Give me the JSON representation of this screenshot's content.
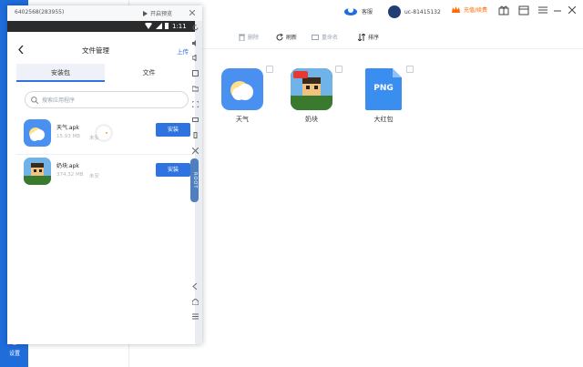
{
  "colors": {
    "accent": "#2f73e0",
    "nav": "#1f6ddb",
    "orange": "#ff6a00"
  },
  "phone": {
    "title": "6402568(283955)",
    "preview_label": "开启预览",
    "status_time": "1:11",
    "side_root": "ROOT",
    "header": {
      "title": "文件管理",
      "upload": "上传"
    },
    "tabs": [
      {
        "label": "安装包",
        "active": true
      },
      {
        "label": "文件",
        "active": false
      }
    ],
    "search_placeholder": "搜索应用程序",
    "apps": [
      {
        "name": "天气.apk",
        "size": "15.93 MB",
        "status": "未安",
        "action": "安装",
        "icon": "weather-icon"
      },
      {
        "name": "奶块.apk",
        "size": "374.32 MB",
        "status": "未安",
        "action": "安装",
        "icon": "game-icon"
      }
    ]
  },
  "top_bar": {
    "message": "客服",
    "user": "uc-81415132",
    "recharge": "充值/续费"
  },
  "toolbar": {
    "delete": "删除",
    "refresh": "刷新",
    "rename": "重命名",
    "sort": "排序"
  },
  "files": [
    {
      "label": "天气",
      "icon": "weather-icon"
    },
    {
      "label": "奶块",
      "icon": "game-icon"
    },
    {
      "label": "大红包",
      "icon": "png-icon",
      "badge": "PNG"
    }
  ],
  "left_nav": {
    "settings": "设置"
  }
}
